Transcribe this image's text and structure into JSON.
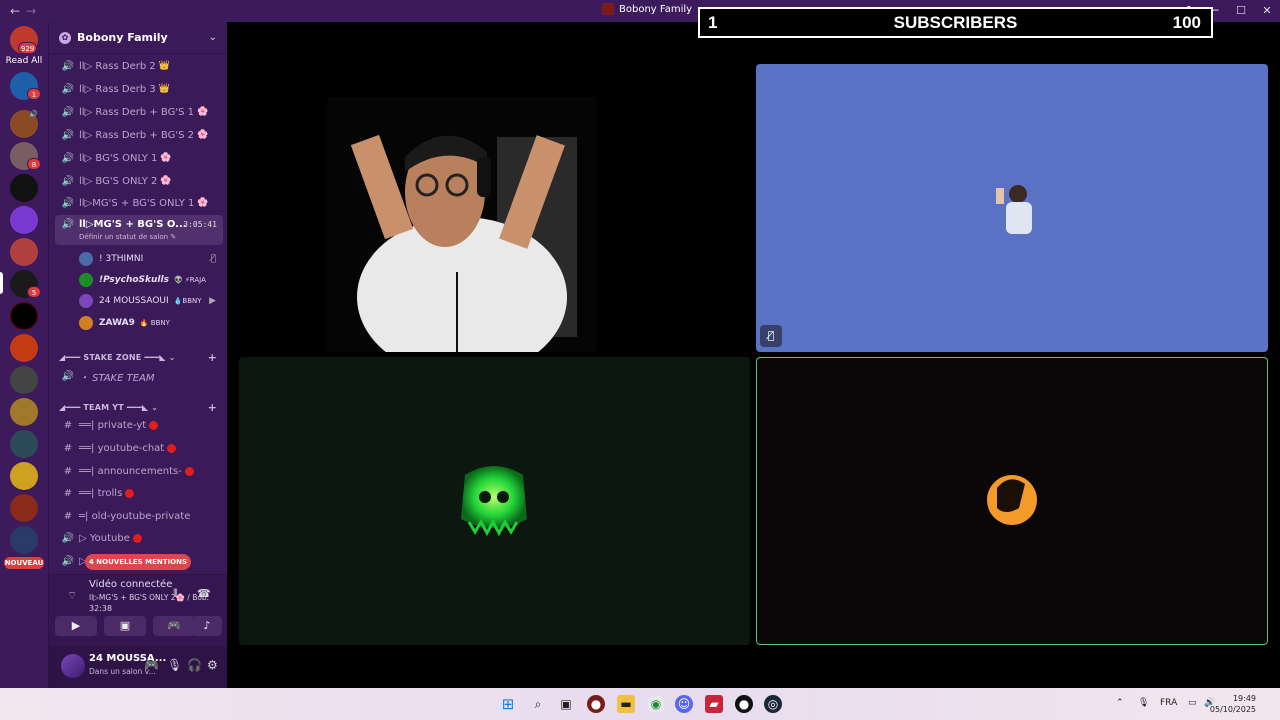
{
  "titlebar": {
    "back": "←",
    "forward": "→",
    "title": "Bobony Family",
    "controls": [
      "─",
      "☐",
      "✕"
    ]
  },
  "rail": {
    "read_all": "Read All",
    "top_badge": "929",
    "badges": [
      "1",
      "8",
      "5"
    ],
    "nouveau": "NOUVEAU"
  },
  "guild": {
    "name": "Bobony Family"
  },
  "channels": [
    {
      "label": "ll▷ Rass Derb 2",
      "emoji": "👑",
      "icon": "speaker-icon"
    },
    {
      "label": "ll▷ Rass Derb 3",
      "emoji": "👑",
      "icon": "speaker-icon"
    },
    {
      "label": "ll▷ Rass Derb + BG'S 1",
      "emoji": "🌸",
      "icon": "speaker-icon"
    },
    {
      "label": "ll▷ Rass Derb + BG'S 2",
      "emoji": "🌸",
      "icon": "speaker-icon"
    },
    {
      "label": "ll▷ BG'S ONLY 1",
      "emoji": "🌸",
      "icon": "speaker-icon"
    },
    {
      "label": "ll▷ BG'S ONLY 2",
      "emoji": "🌸",
      "icon": "speaker-icon"
    },
    {
      "label": "ll▷MG'S + BG'S ONLY 1",
      "emoji": "🌸",
      "icon": "speaker-icon"
    }
  ],
  "active_channel": {
    "label": "ll▷MG'S + BG'S O...",
    "time": "3:05:41",
    "status": "Définir un statut de salon ✎"
  },
  "voice_users": [
    {
      "name": "! 3THIMNI",
      "tag": "",
      "trail": "🎙̸"
    },
    {
      "name": "!PsychoSkulls",
      "tag": "👽 ⚡RAJA",
      "trail": ""
    },
    {
      "name": "24 MOUSSAOUI",
      "tag": "💧BBNY",
      "trail": "▶"
    },
    {
      "name": "ZAWA9",
      "tag": "🔥 BBNY",
      "trail": ""
    }
  ],
  "stake_zone": {
    "category": "◢━━━ STAKE ZONE ━━━◣",
    "channel": "・ STAKE TEAM"
  },
  "team_yt": {
    "category": "◢━━━ TEAM YT ━━━◣",
    "channels": [
      {
        "label": "══| private-yt",
        "dot": true
      },
      {
        "label": "══| youtube-chat",
        "dot": true
      },
      {
        "label": "══| announcements-",
        "dot": true
      },
      {
        "label": "══| trolls",
        "dot": true
      },
      {
        "label": "═| old-youtube-private",
        "dot": false
      },
      {
        "label": "▷ Youtube",
        "dot": true
      }
    ],
    "last_prefix": "▷"
  },
  "mentions": "4 NOUVELLES MENTIONS",
  "voice_panel": {
    "title": "Vidéo connectée",
    "subtitle": "ll▷MG'S + BG'S ONLY 2🌸 / Bob...",
    "time": "32:38"
  },
  "user": {
    "name": "24 MOUSSA...",
    "status": "Dans un salon v..."
  },
  "subscribers": {
    "left": "1",
    "center": "SUBSCRIBERS",
    "right": "100"
  },
  "taskbar": {
    "lang": "FRA",
    "time": "19:49",
    "date": "05/10/2025"
  },
  "colors": {
    "sidebar": "#3a1a58",
    "rail": "#3d1a5b",
    "tile_blue": "#5a72c4",
    "tile_green_dark": "#0c180f",
    "tile_dark": "#0b0607",
    "speaking_border": "#5ec477",
    "mention_red": "#d9484c"
  }
}
